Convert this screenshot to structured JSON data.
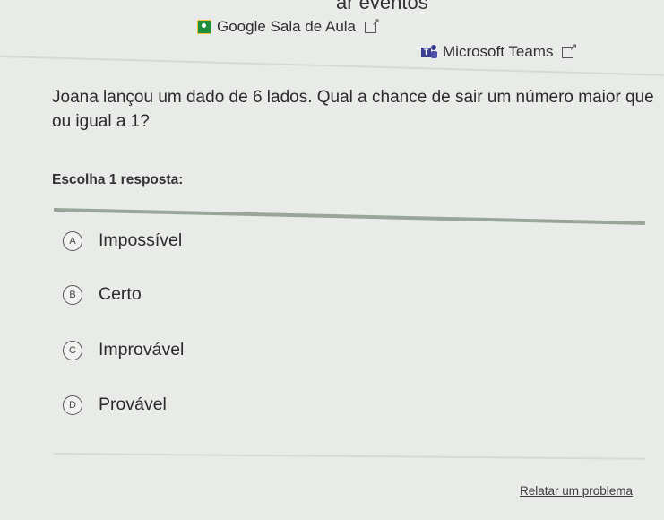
{
  "header": {
    "title": "ar eventos"
  },
  "share": {
    "google_classroom": {
      "label": "Google Sala de Aula",
      "icon": "google-classroom-icon"
    },
    "microsoft_teams": {
      "label": "Microsoft Teams",
      "icon": "microsoft-teams-icon"
    }
  },
  "question": {
    "text": "Joana lançou um dado de 6 lados. Qual a chance de sair um número maior que ou igual a 1?",
    "prompt": "Escolha 1 resposta:"
  },
  "choices": [
    {
      "letter": "A",
      "label": "Impossível"
    },
    {
      "letter": "B",
      "label": "Certo"
    },
    {
      "letter": "C",
      "label": "Improvável"
    },
    {
      "letter": "D",
      "label": "Provável"
    }
  ],
  "footer": {
    "report_label": "Relatar um problema"
  },
  "colors": {
    "background": "#e9ebe8",
    "accent_bar": "#9aa59a",
    "classroom_green": "#1e8e3e",
    "teams_purple": "#3b3f8f"
  }
}
